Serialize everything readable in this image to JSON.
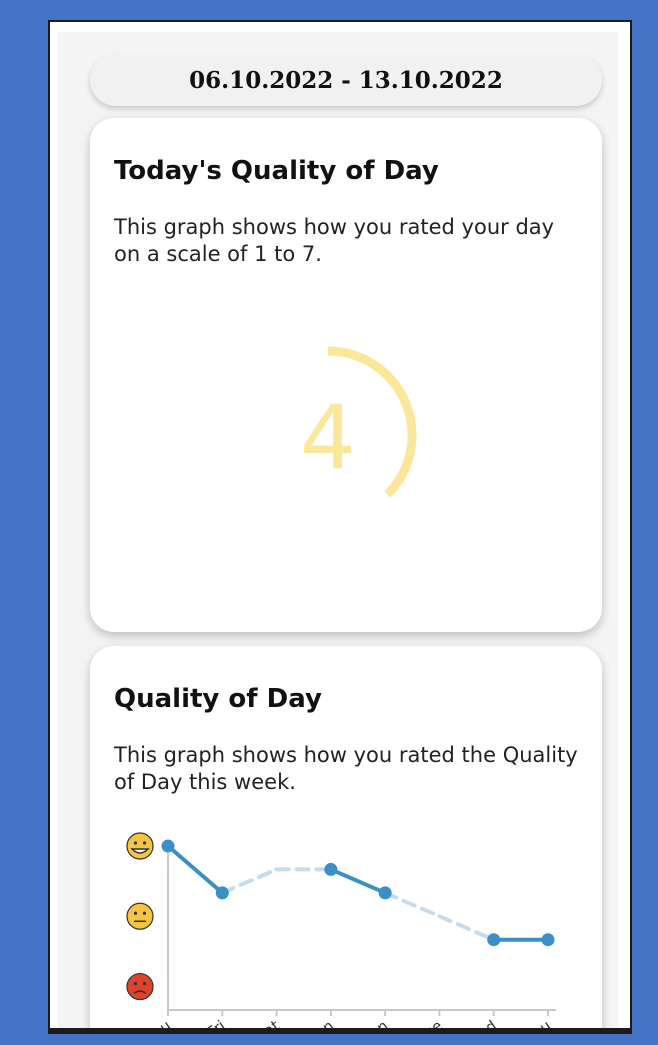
{
  "date_range": "06.10.2022 - 13.10.2022",
  "today_card": {
    "title": "Today's Quality of Day",
    "description": "This graph shows how you rated your day on a scale of 1 to 7.",
    "value": "4",
    "gauge": {
      "value": 4,
      "scale_min": 1,
      "scale_max": 7,
      "color": "#fae79a"
    }
  },
  "week_card": {
    "title": "Quality of Day",
    "description": "This graph shows how you rated the Quality of Day this week.",
    "emoji_levels": [
      {
        "icon": "grinning-face-icon",
        "label": "😁"
      },
      {
        "icon": "neutral-face-icon",
        "label": "😐"
      },
      {
        "icon": "angry-face-icon",
        "label": "😡"
      }
    ]
  },
  "chart_data": {
    "type": "line",
    "categories": [
      "Thu",
      "Fri",
      "Sat",
      "Sun",
      "Mon",
      "Tue",
      "Wed",
      "Thu"
    ],
    "x_tick_labels": [
      "hu",
      "Fri",
      "Sat",
      "un",
      "on",
      "ue",
      "ed",
      "hu"
    ],
    "values": [
      7,
      5,
      6,
      6,
      5,
      4,
      3,
      3
    ],
    "dashed_segments": [
      [
        1,
        3
      ],
      [
        4,
        6
      ]
    ],
    "ylim": [
      0,
      7
    ],
    "line_color": "#3a8fc7",
    "dashed_color": "#c4dcee",
    "axis_color": "#c8c8c8"
  }
}
